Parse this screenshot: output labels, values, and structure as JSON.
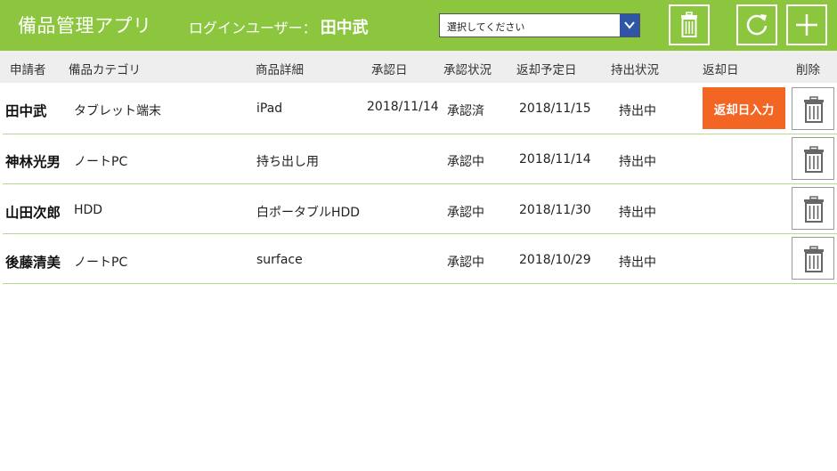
{
  "header": {
    "title": "備品管理アプリ",
    "login_label": "ログインユーザー：",
    "login_user": "田中武",
    "select": {
      "value": "選択してください"
    },
    "buttons": {
      "trash_icon": "trash-icon",
      "refresh_icon": "refresh-icon",
      "add_icon": "plus-icon"
    }
  },
  "columns": [
    "申請者",
    "備品カテゴリ",
    "商品詳細",
    "承認日",
    "承認状況",
    "返却予定日",
    "持出状況",
    "返却日",
    "削除"
  ],
  "rows": [
    {
      "applicant": "田中武",
      "category": "タブレット端末",
      "detail": "iPad",
      "approval_date": "2018/11/14",
      "approval_status": "承認済",
      "due_date": "2018/11/15",
      "checkout_status": "持出中",
      "return_button": "返却日入力"
    },
    {
      "applicant": "神林光男",
      "category": "ノートPC",
      "detail": "持ち出し用",
      "approval_date": "",
      "approval_status": "承認中",
      "due_date": "2018/11/14",
      "checkout_status": "持出中",
      "return_button": ""
    },
    {
      "applicant": "山田次郎",
      "category": "HDD",
      "detail": "白ポータブルHDD",
      "approval_date": "",
      "approval_status": "承認中",
      "due_date": "2018/11/30",
      "checkout_status": "持出中",
      "return_button": ""
    },
    {
      "applicant": "後藤清美",
      "category": "ノートPC",
      "detail": "surface",
      "approval_date": "",
      "approval_status": "承認中",
      "due_date": "2018/10/29",
      "checkout_status": "持出中",
      "return_button": ""
    }
  ],
  "colors": {
    "header_bg": "#8cc63f",
    "accent_orange": "#f26522",
    "select_arrow": "#2f56a6"
  }
}
